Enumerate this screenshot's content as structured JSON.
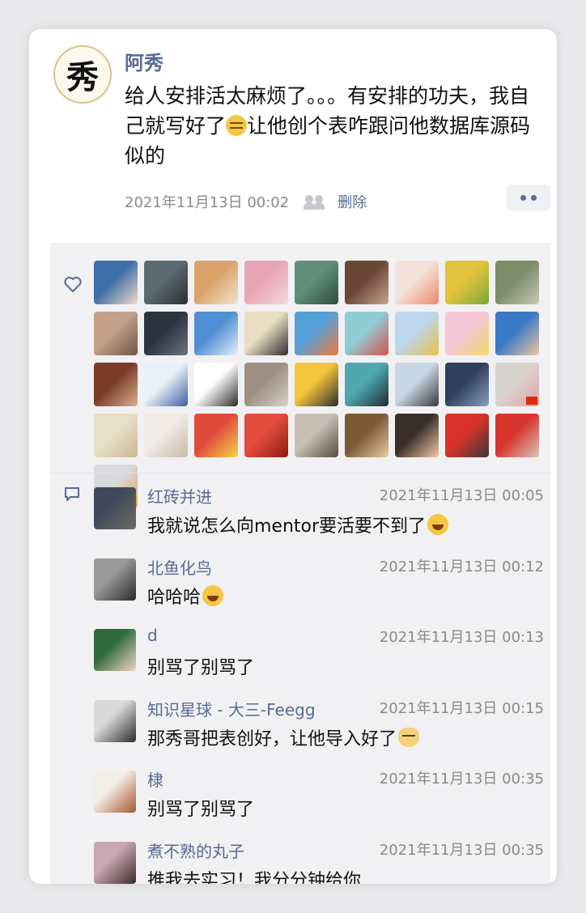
{
  "post": {
    "author": "阿秀",
    "avatar_glyph": "秀",
    "text_before": "给人安排活太麻烦了。。。有安排的功夫，我自己就写好了",
    "text_after": "让他创个表咋跟问他数据库源码似的",
    "inline_emoji": "smirk-emoji",
    "timestamp": "2021年11月13日 00:02",
    "privacy_icon": "friends-icon",
    "delete_label": "删除",
    "more_icon": "more-dots-icon"
  },
  "likes": {
    "icon": "heart-icon",
    "avatars": [
      {
        "c1": "#3d6fa8",
        "c2": "#f2dcc8"
      },
      {
        "c1": "#5b6a72",
        "c2": "#2e2e2e"
      },
      {
        "c1": "#d9a36b",
        "c2": "#f1e3cc"
      },
      {
        "c1": "#e8a6b6",
        "c2": "#f5d6e0"
      },
      {
        "c1": "#5f8e7a",
        "c2": "#2f4a40"
      },
      {
        "c1": "#6a4636",
        "c2": "#caa38e"
      },
      {
        "c1": "#f3e2da",
        "c2": "#e98a6a"
      },
      {
        "c1": "#e3c33c",
        "c2": "#7ba83a"
      },
      {
        "c1": "#7b8c6a",
        "c2": "#c9c9b6"
      },
      {
        "c1": "#c4a28a",
        "c2": "#6d5446"
      },
      {
        "c1": "#2a3340",
        "c2": "#6d7480"
      },
      {
        "c1": "#4f8fd3",
        "c2": "#e5eef7"
      },
      {
        "c1": "#e9dcc0",
        "c2": "#2d2d2d"
      },
      {
        "c1": "#56a0d8",
        "c2": "#f07a3a"
      },
      {
        "c1": "#8fcdd6",
        "c2": "#d84f4f"
      },
      {
        "c1": "#bcd7ee",
        "c2": "#e8c04a"
      },
      {
        "c1": "#f5c7d9",
        "c2": "#f4d66b"
      },
      {
        "c1": "#3a79c7",
        "c2": "#f3c6a0"
      },
      {
        "c1": "#7a3a2a",
        "c2": "#d9b18e"
      },
      {
        "c1": "#e9f1f8",
        "c2": "#3d5fa0"
      },
      {
        "c1": "#ffffff",
        "c2": "#2b2b2b"
      },
      {
        "c1": "#9e8f82",
        "c2": "#d8d1c7"
      },
      {
        "c1": "#f4c43c",
        "c2": "#2d2d2d"
      },
      {
        "c1": "#4fa8b0",
        "c2": "#1f2d33"
      },
      {
        "c1": "#c9d8e6",
        "c2": "#3a3a3a"
      },
      {
        "c1": "#2f3f5c",
        "c2": "#8aa0bf"
      },
      {
        "c1": "#d8d4d0",
        "c2": "#e2a0a6"
      },
      {
        "c1": "#e8dfc8",
        "c2": "#c9b890"
      },
      {
        "c1": "#f0ebe4",
        "c2": "#c8b9a8"
      },
      {
        "c1": "#e04a3a",
        "c2": "#f4d34a"
      },
      {
        "c1": "#e34b3c",
        "c2": "#8e1b14"
      },
      {
        "c1": "#c8bfb4",
        "c2": "#5a4a40"
      },
      {
        "c1": "#7a5a36",
        "c2": "#e9c9a0"
      },
      {
        "c1": "#3a2e28",
        "c2": "#f0c8a8"
      },
      {
        "c1": "#d9322a",
        "c2": "#3a3a3a"
      },
      {
        "c1": "#d8342e",
        "c2": "#d8c6b8"
      },
      {
        "c1": "#d9d9de",
        "c2": "#e3a446"
      }
    ],
    "flag_indices": [
      26,
      36
    ]
  },
  "comments": {
    "icon": "comment-bubble-icon",
    "items": [
      {
        "name": "红砖并进",
        "time": "2021年11月13日 00:05",
        "text": "我就说怎么向mentor要活要不到了",
        "emoji": "laughing-crying-emoji",
        "c1": "#3e4a5a",
        "c2": "#6f6a64"
      },
      {
        "name": "北鱼化鸟",
        "time": "2021年11月13日 00:12",
        "text": "哈哈哈",
        "emoji": "laughing-crying-emoji",
        "c1": "#9b9b9b",
        "c2": "#2a2a2a"
      },
      {
        "name": "d",
        "time": "2021年11月13日 00:13",
        "text": "别骂了别骂了",
        "emoji": "",
        "c1": "#2f6a3a",
        "c2": "#f0d6c0"
      },
      {
        "name": "知识星球 - 大三-Feegg",
        "time": "2021年11月13日 00:15",
        "text": "那秀哥把表创好，让他导入好了",
        "emoji": "cat-emoji",
        "c1": "#d9d9d9",
        "c2": "#2b2b2b"
      },
      {
        "name": "棣",
        "time": "2021年11月13日 00:35",
        "text": "别骂了别骂了",
        "emoji": "",
        "c1": "#f3eee6",
        "c2": "#a5562e"
      },
      {
        "name": "煮不熟的丸子",
        "time": "2021年11月13日 00:35",
        "text": "推我去实习！我分分钟给你",
        "emoji": "",
        "c1": "#c9a6b2",
        "c2": "#3a2c2c"
      }
    ]
  }
}
